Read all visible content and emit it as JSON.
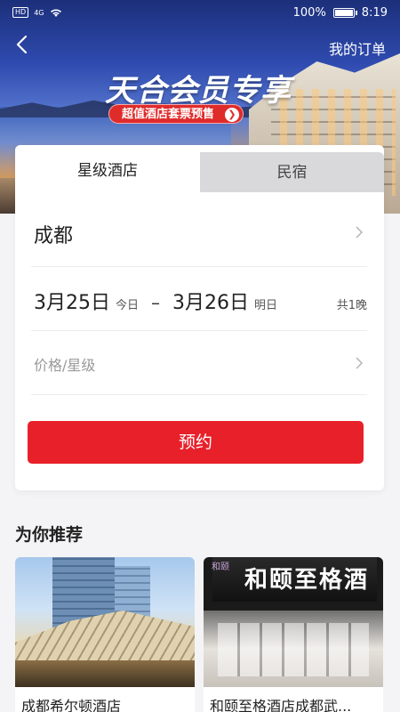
{
  "status_bar": {
    "hd_badge": "HD",
    "network": "4G",
    "battery_percent": "100%",
    "battery_level": 1.0,
    "time": "8:19"
  },
  "header": {
    "orders_link": "我的订单",
    "banner_title": "天合会员专享",
    "promo_text": "超值酒店套票预售"
  },
  "tabs": [
    {
      "label": "星级酒店",
      "active": true
    },
    {
      "label": "民宿",
      "active": false
    }
  ],
  "search_form": {
    "city": "成都",
    "checkin_date": "3月25日",
    "checkin_label": "今日",
    "separator": "–",
    "checkout_date": "3月26日",
    "checkout_label": "明日",
    "nights": "共1晚",
    "price_star_placeholder": "价格/星级",
    "book_button": "预约"
  },
  "recommendations": {
    "title": "为你推荐",
    "items": [
      {
        "name": "成都希尔顿酒店"
      },
      {
        "name": "和颐至格酒店成都武...",
        "sign_text": "和颐至格酒店",
        "logo_text": "和颐"
      }
    ]
  },
  "colors": {
    "accent_red": "#e8202a",
    "tab_inactive_bg": "#d9d9dc",
    "page_bg": "#f4f4f6"
  }
}
